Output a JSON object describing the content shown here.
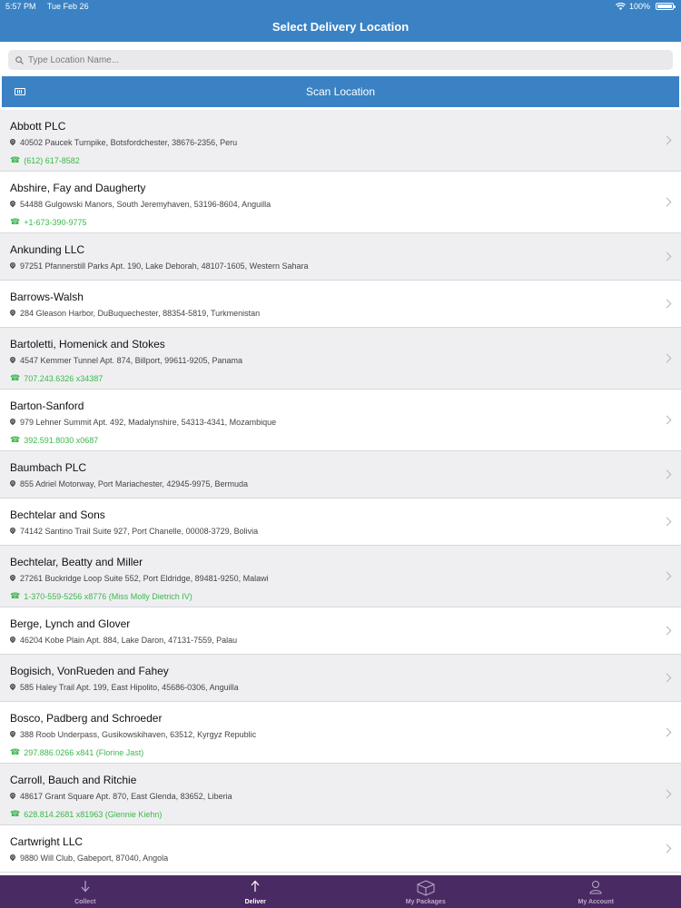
{
  "status_bar": {
    "time": "5:57 PM",
    "date": "Tue Feb 26",
    "battery": "100%"
  },
  "header": {
    "title": "Select Delivery Location"
  },
  "search": {
    "placeholder": "Type Location Name..."
  },
  "scan": {
    "label": "Scan Location"
  },
  "locations": [
    {
      "name": "Abbott PLC",
      "address": "40502 Paucek Turnpike, Botsfordchester, 38676-2356, Peru",
      "phone": "(612) 617-8582"
    },
    {
      "name": "Abshire, Fay and Daugherty",
      "address": "54488 Gulgowski Manors, South Jeremyhaven, 53196-8604, Anguilla",
      "phone": "+1-673-390-9775"
    },
    {
      "name": "Ankunding LLC",
      "address": "97251 Pfannerstill Parks Apt. 190, Lake Deborah, 48107-1605, Western Sahara",
      "phone": ""
    },
    {
      "name": "Barrows-Walsh",
      "address": "284 Gleason Harbor, DuBuquechester, 88354-5819, Turkmenistan",
      "phone": ""
    },
    {
      "name": "Bartoletti, Homenick and Stokes",
      "address": "4547 Kemmer Tunnel Apt. 874, Billport, 99611-9205, Panama",
      "phone": "707.243.6326 x34387"
    },
    {
      "name": "Barton-Sanford",
      "address": "979 Lehner Summit Apt. 492, Madalynshire, 54313-4341, Mozambique",
      "phone": "392.591.8030 x0687"
    },
    {
      "name": "Baumbach PLC",
      "address": "855 Adriel Motorway, Port Mariachester, 42945-9975, Bermuda",
      "phone": ""
    },
    {
      "name": "Bechtelar and Sons",
      "address": "74142 Santino Trail Suite 927, Port Chanelle, 00008-3729, Bolivia",
      "phone": ""
    },
    {
      "name": "Bechtelar, Beatty and Miller",
      "address": "27261 Buckridge Loop Suite 552, Port Eldridge, 89481-9250, Malawi",
      "phone": "1-370-559-5256 x8776 (Miss Molly Dietrich IV)"
    },
    {
      "name": "Berge, Lynch and Glover",
      "address": "46204 Kobe Plain Apt. 884, Lake Daron, 47131-7559, Palau",
      "phone": ""
    },
    {
      "name": "Bogisich, VonRueden and Fahey",
      "address": "585 Haley Trail Apt. 199, East Hipolito, 45686-0306, Anguilla",
      "phone": ""
    },
    {
      "name": "Bosco, Padberg and Schroeder",
      "address": "388 Roob Underpass, Gusikowskihaven, 63512, Kyrgyz Republic",
      "phone": "297.886.0266 x841 (Florine Jast)"
    },
    {
      "name": "Carroll, Bauch and Ritchie",
      "address": "48617 Grant Square Apt. 870, East Glenda, 83652, Liberia",
      "phone": "628.814.2681 x81963 (Glennie Kiehn)"
    },
    {
      "name": "Cartwright LLC",
      "address": "9880 Will Club, Gabeport, 87040, Angola",
      "phone": ""
    }
  ],
  "tabs": [
    {
      "label": "Collect",
      "icon": "arrow-down-icon",
      "active": false
    },
    {
      "label": "Deliver",
      "icon": "arrow-up-icon",
      "active": true
    },
    {
      "label": "My Packages",
      "icon": "box-icon",
      "active": false
    },
    {
      "label": "My Account",
      "icon": "person-icon",
      "active": false
    }
  ]
}
